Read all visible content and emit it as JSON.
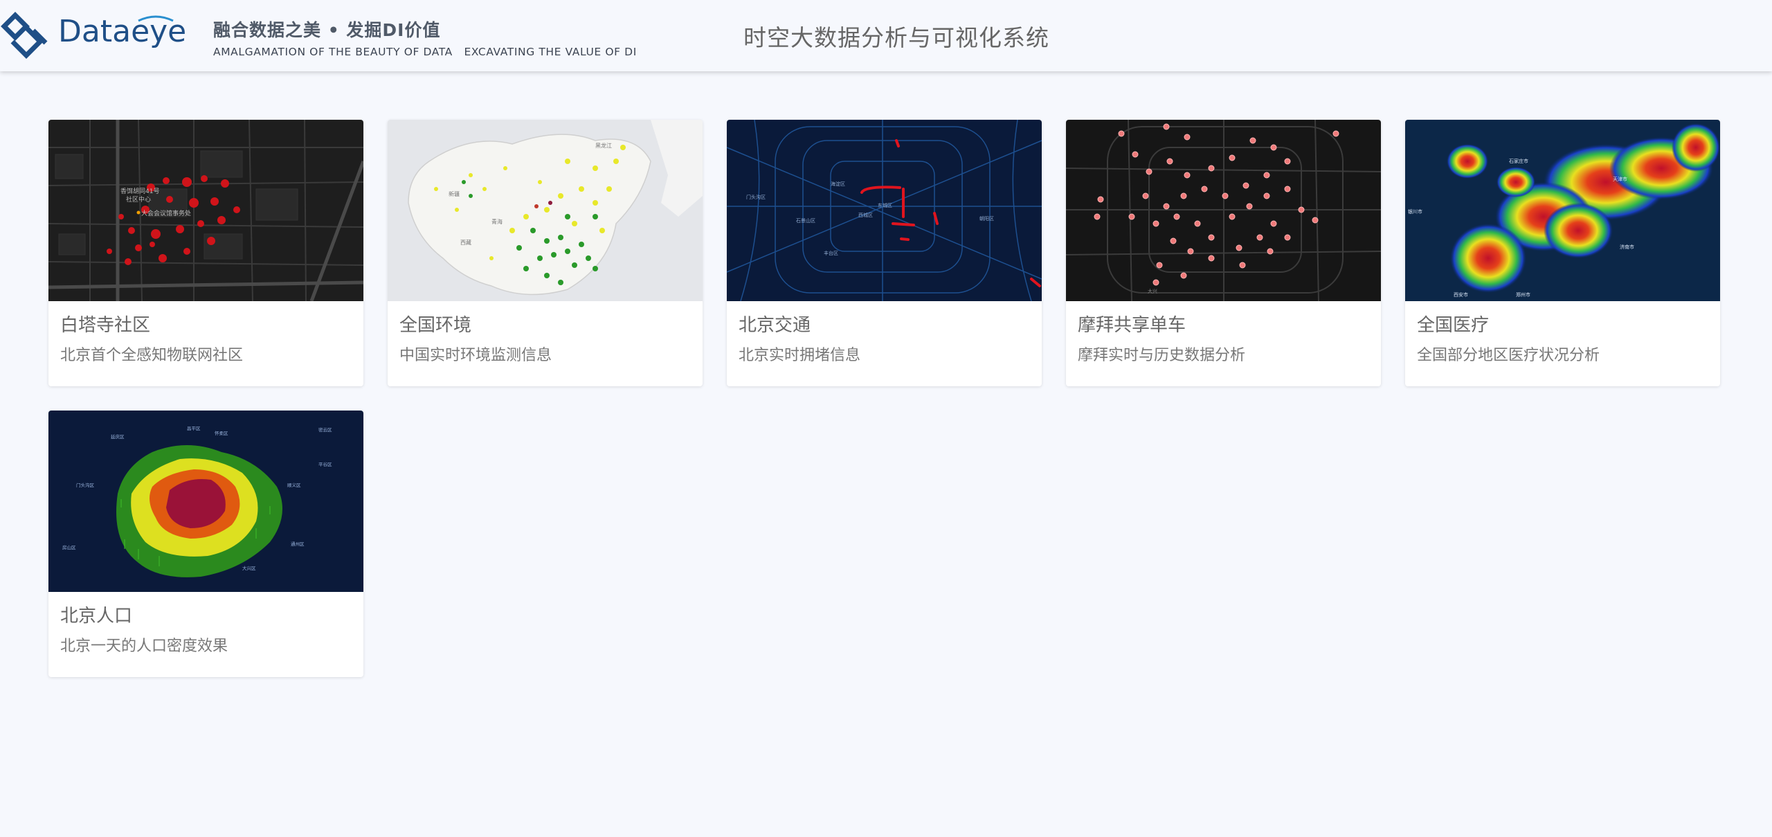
{
  "header": {
    "logo_text_a": "Data",
    "logo_text_b": "eye",
    "slogan_cn": "融合数据之美 • 发掘DI价值",
    "slogan_en": "AMALGAMATION OF THE BEAUTY OF DATA   EXCAVATING THE VALUE OF DI",
    "title": "时空大数据分析与可视化系统"
  },
  "colors": {
    "brand": "#1f4f87",
    "page_bg": "#f6f8fd",
    "dark_map": "#1a1a1a",
    "navy_map": "#0a1a3a"
  },
  "cards": [
    {
      "title": "白塔寺社区",
      "desc": "北京首个全感知物联网社区",
      "thumb_icon": "dark-street-map-red-dots"
    },
    {
      "title": "全国环境",
      "desc": "中国实时环境监测信息",
      "thumb_icon": "china-map-yellow-green-dots"
    },
    {
      "title": "北京交通",
      "desc": "北京实时拥堵信息",
      "thumb_icon": "navy-road-map-red-segments"
    },
    {
      "title": "摩拜共享单车",
      "desc": "摩拜实时与历史数据分析",
      "thumb_icon": "dark-map-pink-pins"
    },
    {
      "title": "全国医疗",
      "desc": "全国部分地区医疗状况分析",
      "thumb_icon": "navy-heatmap"
    },
    {
      "title": "北京人口",
      "desc": "北京一天的人口密度效果",
      "thumb_icon": "navy-3d-density-map"
    }
  ],
  "thumb_labels": {
    "card1": [
      "香饵胡同41号",
      "社区中心",
      "大会会议馆事务处"
    ],
    "card2": [
      "新疆",
      "西藏",
      "青海",
      "黑龙江"
    ],
    "card3": [
      "门头沟区",
      "石景山区",
      "西城区",
      "东城区",
      "朝阳区",
      "海淀区",
      "丰台区"
    ],
    "card4": [
      "大兴"
    ],
    "card5": [
      "石家庄市",
      "天津市",
      "济南市",
      "郑州市",
      "银川市",
      "西安市"
    ],
    "card6": [
      "延庆区",
      "怀柔区",
      "密云区",
      "平谷区",
      "顺义区",
      "通州区",
      "大兴区",
      "房山区",
      "门头沟区",
      "昌平区"
    ]
  }
}
